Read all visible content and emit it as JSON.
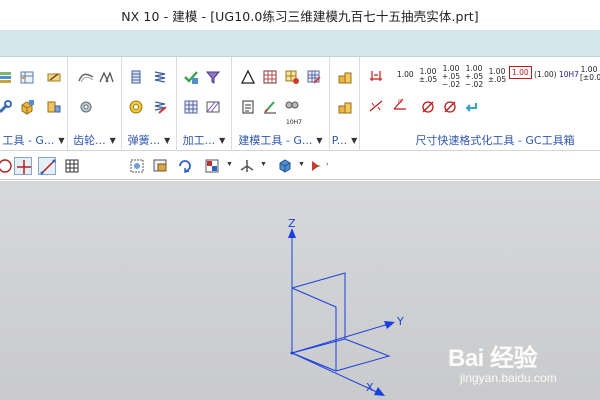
{
  "window": {
    "title": "NX 10 - 建模 - [UG10.0练习三维建模九百七十五抽壳实体.prt]"
  },
  "ribbon": {
    "groups": [
      {
        "label": "工具 - G...",
        "has_dropdown": true
      },
      {
        "label": "齿轮...",
        "has_dropdown": true
      },
      {
        "label": "弹簧...",
        "has_dropdown": true
      },
      {
        "label": "加工...",
        "has_dropdown": true
      },
      {
        "label": "建模工具 - G...",
        "has_dropdown": true
      },
      {
        "label": "P...",
        "has_dropdown": true
      },
      {
        "label": "尺寸快速格式化工具 - GC工具箱",
        "has_dropdown": false
      }
    ],
    "dimension_tools": {
      "row1": [
        "1.00",
        "1.00 ±.05",
        "1.00 +.05 −.02",
        "1.00 +.05 −.02",
        "1.00 ±.05",
        "1.00",
        "(1.00)",
        "10H7",
        "1.00 [±0.05]"
      ],
      "row2_label": "10H7"
    }
  },
  "toolbar": {
    "buttons": [
      "snap-circle-icon",
      "snap-point-icon",
      "snap-line-icon",
      "grid-icon",
      "fit-view-icon",
      "zoom-window-icon",
      "rotate-icon",
      "render-style-icon",
      "view-orient-icon",
      "display-shaded-icon",
      "more-icon"
    ]
  },
  "viewport": {
    "axes": {
      "z": "Z",
      "y": "Y",
      "x": "X"
    },
    "colors": {
      "background": "#cfd0d2",
      "wcs": "#1a3fe0"
    }
  },
  "watermark": {
    "logo": "Bai 经验",
    "site": "jingyan.baidu.com"
  }
}
